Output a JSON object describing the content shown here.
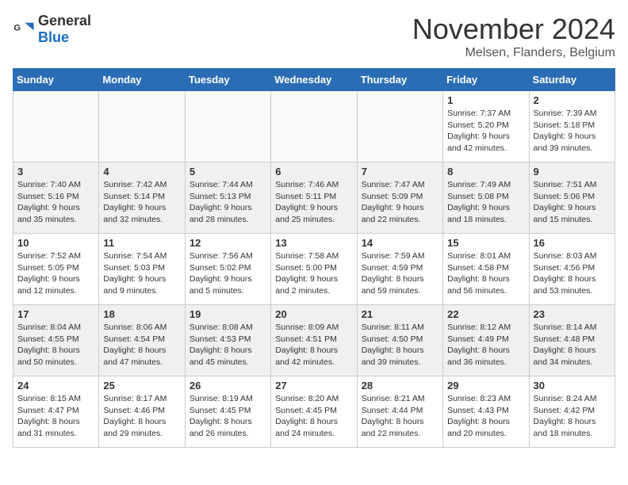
{
  "logo": {
    "general": "General",
    "blue": "Blue"
  },
  "title": "November 2024",
  "location": "Melsen, Flanders, Belgium",
  "headers": [
    "Sunday",
    "Monday",
    "Tuesday",
    "Wednesday",
    "Thursday",
    "Friday",
    "Saturday"
  ],
  "weeks": [
    [
      {
        "day": "",
        "info": "",
        "empty": true
      },
      {
        "day": "",
        "info": "",
        "empty": true
      },
      {
        "day": "",
        "info": "",
        "empty": true
      },
      {
        "day": "",
        "info": "",
        "empty": true
      },
      {
        "day": "",
        "info": "",
        "empty": true
      },
      {
        "day": "1",
        "info": "Sunrise: 7:37 AM\nSunset: 5:20 PM\nDaylight: 9 hours and 42 minutes."
      },
      {
        "day": "2",
        "info": "Sunrise: 7:39 AM\nSunset: 5:18 PM\nDaylight: 9 hours and 39 minutes."
      }
    ],
    [
      {
        "day": "3",
        "info": "Sunrise: 7:40 AM\nSunset: 5:16 PM\nDaylight: 9 hours and 35 minutes.",
        "shaded": true
      },
      {
        "day": "4",
        "info": "Sunrise: 7:42 AM\nSunset: 5:14 PM\nDaylight: 9 hours and 32 minutes.",
        "shaded": true
      },
      {
        "day": "5",
        "info": "Sunrise: 7:44 AM\nSunset: 5:13 PM\nDaylight: 9 hours and 28 minutes.",
        "shaded": true
      },
      {
        "day": "6",
        "info": "Sunrise: 7:46 AM\nSunset: 5:11 PM\nDaylight: 9 hours and 25 minutes.",
        "shaded": true
      },
      {
        "day": "7",
        "info": "Sunrise: 7:47 AM\nSunset: 5:09 PM\nDaylight: 9 hours and 22 minutes.",
        "shaded": true
      },
      {
        "day": "8",
        "info": "Sunrise: 7:49 AM\nSunset: 5:08 PM\nDaylight: 9 hours and 18 minutes.",
        "shaded": true
      },
      {
        "day": "9",
        "info": "Sunrise: 7:51 AM\nSunset: 5:06 PM\nDaylight: 9 hours and 15 minutes.",
        "shaded": true
      }
    ],
    [
      {
        "day": "10",
        "info": "Sunrise: 7:52 AM\nSunset: 5:05 PM\nDaylight: 9 hours and 12 minutes."
      },
      {
        "day": "11",
        "info": "Sunrise: 7:54 AM\nSunset: 5:03 PM\nDaylight: 9 hours and 9 minutes."
      },
      {
        "day": "12",
        "info": "Sunrise: 7:56 AM\nSunset: 5:02 PM\nDaylight: 9 hours and 5 minutes."
      },
      {
        "day": "13",
        "info": "Sunrise: 7:58 AM\nSunset: 5:00 PM\nDaylight: 9 hours and 2 minutes."
      },
      {
        "day": "14",
        "info": "Sunrise: 7:59 AM\nSunset: 4:59 PM\nDaylight: 8 hours and 59 minutes."
      },
      {
        "day": "15",
        "info": "Sunrise: 8:01 AM\nSunset: 4:58 PM\nDaylight: 8 hours and 56 minutes."
      },
      {
        "day": "16",
        "info": "Sunrise: 8:03 AM\nSunset: 4:56 PM\nDaylight: 8 hours and 53 minutes."
      }
    ],
    [
      {
        "day": "17",
        "info": "Sunrise: 8:04 AM\nSunset: 4:55 PM\nDaylight: 8 hours and 50 minutes.",
        "shaded": true
      },
      {
        "day": "18",
        "info": "Sunrise: 8:06 AM\nSunset: 4:54 PM\nDaylight: 8 hours and 47 minutes.",
        "shaded": true
      },
      {
        "day": "19",
        "info": "Sunrise: 8:08 AM\nSunset: 4:53 PM\nDaylight: 8 hours and 45 minutes.",
        "shaded": true
      },
      {
        "day": "20",
        "info": "Sunrise: 8:09 AM\nSunset: 4:51 PM\nDaylight: 8 hours and 42 minutes.",
        "shaded": true
      },
      {
        "day": "21",
        "info": "Sunrise: 8:11 AM\nSunset: 4:50 PM\nDaylight: 8 hours and 39 minutes.",
        "shaded": true
      },
      {
        "day": "22",
        "info": "Sunrise: 8:12 AM\nSunset: 4:49 PM\nDaylight: 8 hours and 36 minutes.",
        "shaded": true
      },
      {
        "day": "23",
        "info": "Sunrise: 8:14 AM\nSunset: 4:48 PM\nDaylight: 8 hours and 34 minutes.",
        "shaded": true
      }
    ],
    [
      {
        "day": "24",
        "info": "Sunrise: 8:15 AM\nSunset: 4:47 PM\nDaylight: 8 hours and 31 minutes."
      },
      {
        "day": "25",
        "info": "Sunrise: 8:17 AM\nSunset: 4:46 PM\nDaylight: 8 hours and 29 minutes."
      },
      {
        "day": "26",
        "info": "Sunrise: 8:19 AM\nSunset: 4:45 PM\nDaylight: 8 hours and 26 minutes."
      },
      {
        "day": "27",
        "info": "Sunrise: 8:20 AM\nSunset: 4:45 PM\nDaylight: 8 hours and 24 minutes."
      },
      {
        "day": "28",
        "info": "Sunrise: 8:21 AM\nSunset: 4:44 PM\nDaylight: 8 hours and 22 minutes."
      },
      {
        "day": "29",
        "info": "Sunrise: 8:23 AM\nSunset: 4:43 PM\nDaylight: 8 hours and 20 minutes."
      },
      {
        "day": "30",
        "info": "Sunrise: 8:24 AM\nSunset: 4:42 PM\nDaylight: 8 hours and 18 minutes."
      }
    ]
  ]
}
